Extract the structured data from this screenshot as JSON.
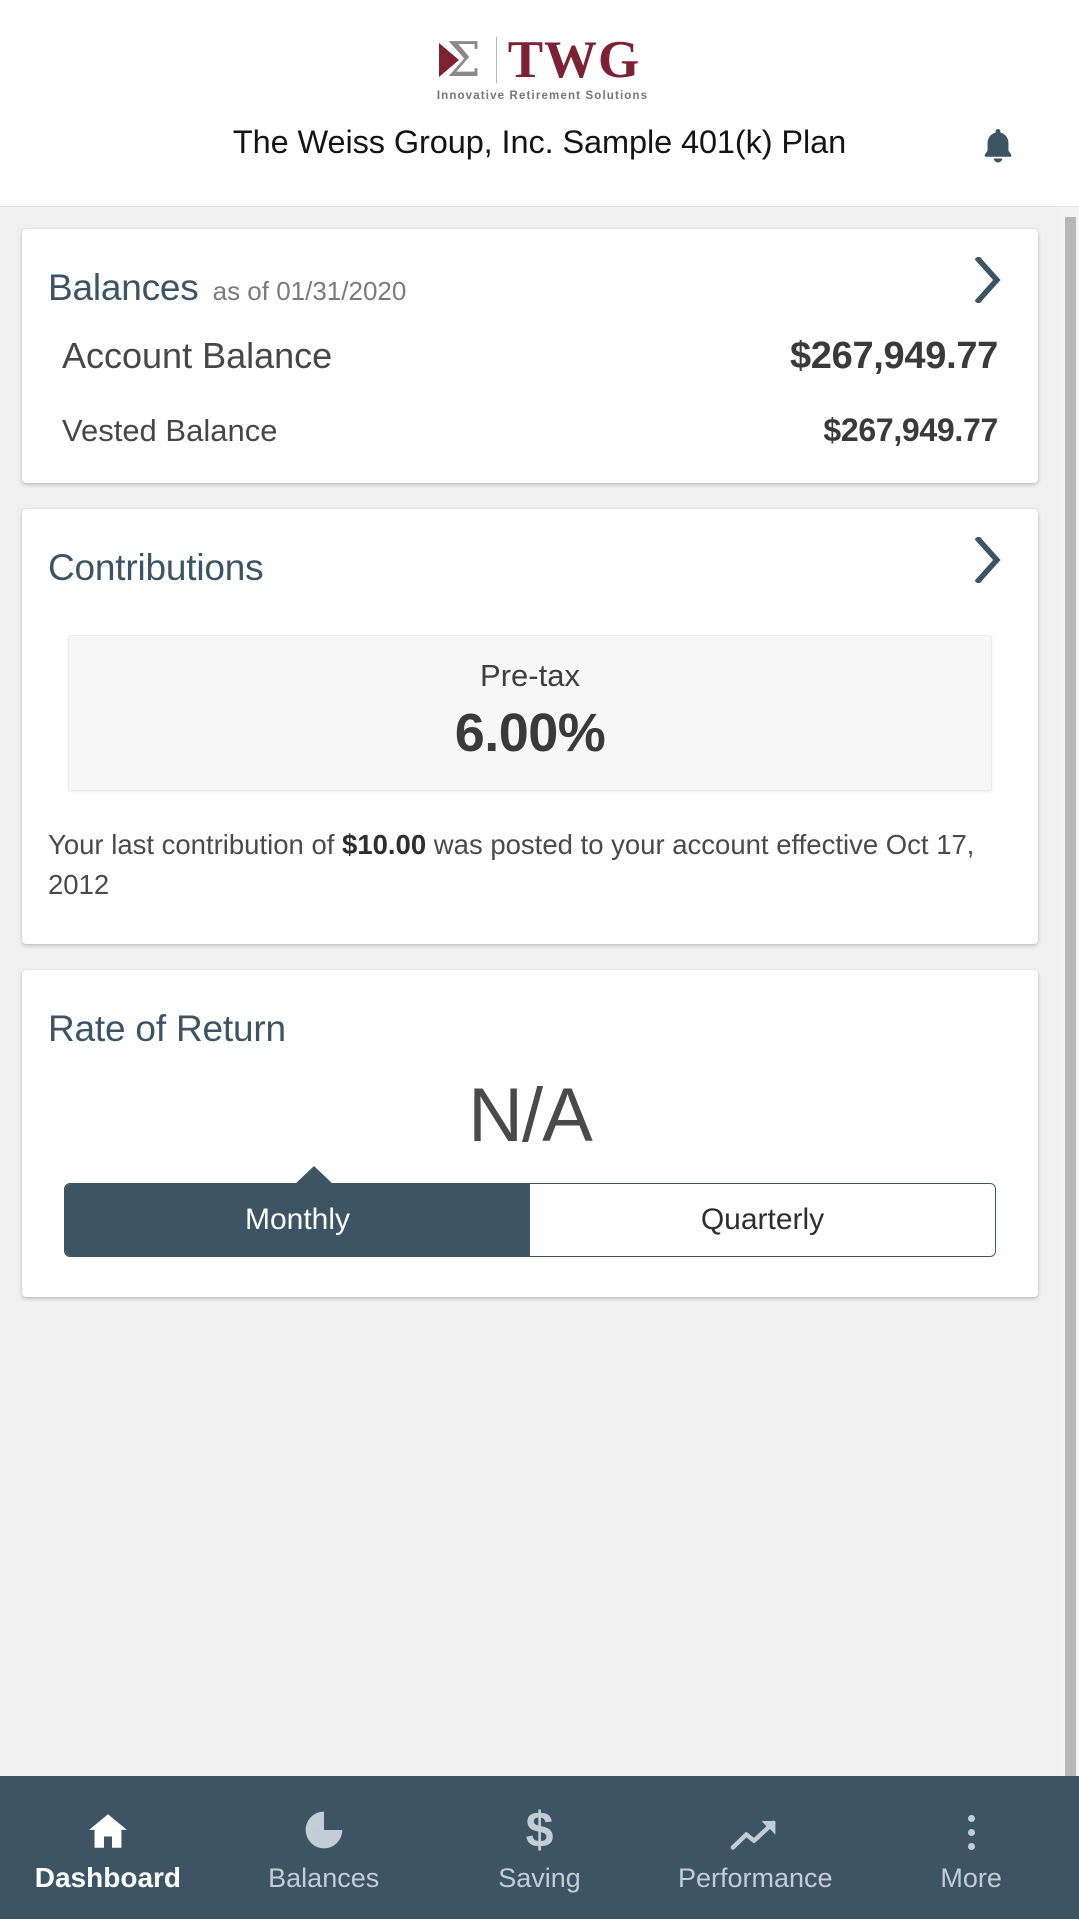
{
  "brand": {
    "logo_mark": "sigma-icon",
    "name": "TWG",
    "tagline": "Innovative Retirement Solutions"
  },
  "header": {
    "plan_title": "The Weiss Group, Inc. Sample 401(k) Plan",
    "notification_icon": "bell-icon"
  },
  "colors": {
    "accent": "#3d5465",
    "brand_maroon": "#7c2232",
    "page_bg": "#f1f1f1",
    "card_bg": "#ffffff",
    "nav_label_inactive": "#c3cdd5"
  },
  "balances_card": {
    "title": "Balances",
    "subtitle": "as of 01/31/2020",
    "chevron_icon": "chevron-right-icon",
    "rows": [
      {
        "label": "Account Balance",
        "value": "$267,949.77"
      },
      {
        "label": "Vested Balance",
        "value": "$267,949.77"
      }
    ]
  },
  "contributions_card": {
    "title": "Contributions",
    "chevron_icon": "chevron-right-icon",
    "rate_kind": "Pre-tax",
    "rate_value": "6.00%",
    "note_prefix": "Your last contribution of ",
    "note_amount": "$10.00",
    "note_suffix": " was posted to your account effective Oct 17, 2012"
  },
  "rate_of_return_card": {
    "title": "Rate of Return",
    "value": "N/A",
    "toggle": {
      "selected": "Monthly",
      "options": [
        {
          "label": "Monthly",
          "active": true
        },
        {
          "label": "Quarterly",
          "active": false
        }
      ]
    }
  },
  "bottom_nav": {
    "items": [
      {
        "label": "Dashboard",
        "icon": "home-icon",
        "active": true
      },
      {
        "label": "Balances",
        "icon": "pie-chart-icon",
        "active": false
      },
      {
        "label": "Saving",
        "icon": "dollar-icon",
        "active": false
      },
      {
        "label": "Performance",
        "icon": "trending-up-icon",
        "active": false
      },
      {
        "label": "More",
        "icon": "more-vertical-icon",
        "active": false
      }
    ]
  },
  "scrollbar": {
    "name": "vertical-scrollbar"
  }
}
